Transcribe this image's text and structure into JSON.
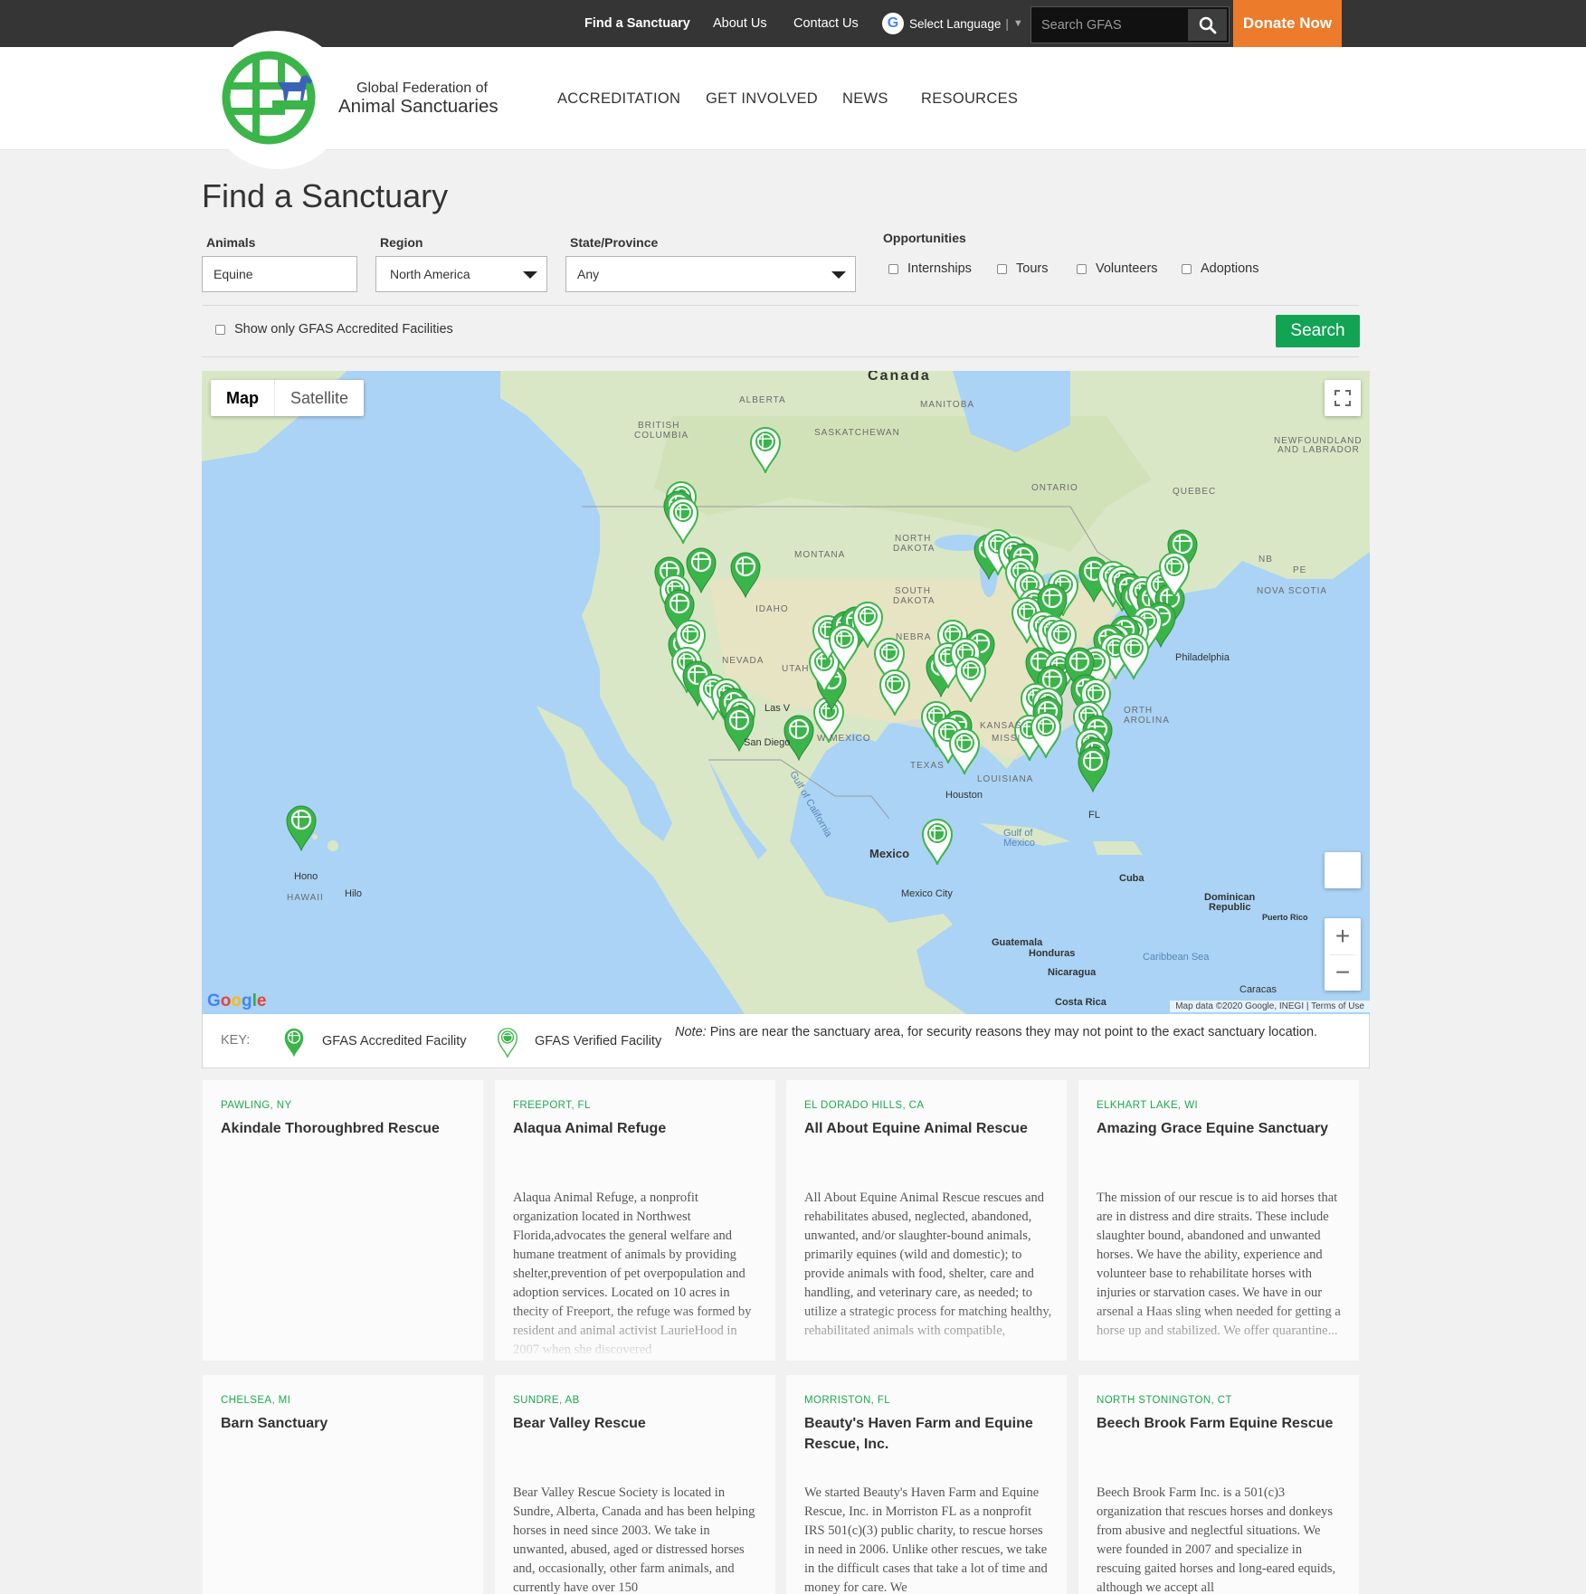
{
  "topbar": {
    "nav": [
      "Find a Sanctuary",
      "About Us",
      "Contact Us"
    ],
    "language_label": "Select Language",
    "language_separator": "|",
    "search_placeholder": "Search GFAS",
    "donate_label": "Donate Now"
  },
  "header": {
    "brand_line1": "Global Federation of",
    "brand_line2": "Animal Sanctuaries",
    "nav": [
      "ACCREDITATION",
      "GET INVOLVED",
      "NEWS",
      "RESOURCES"
    ]
  },
  "page": {
    "title": "Find a Sanctuary"
  },
  "filters": {
    "animals": {
      "label": "Animals",
      "value": "Equine"
    },
    "region": {
      "label": "Region",
      "value": "North America"
    },
    "state": {
      "label": "State/Province",
      "value": "Any"
    },
    "opportunities": {
      "label": "Opportunities",
      "options": [
        "Internships",
        "Tours",
        "Volunteers",
        "Adoptions"
      ]
    },
    "accredited_only_label": "Show only GFAS Accredited Facilities",
    "search_label": "Search"
  },
  "map": {
    "type_map": "Map",
    "type_satellite": "Satellite",
    "labels": {
      "canada": "Canada",
      "alberta": "ALBERTA",
      "manitoba": "MANITOBA",
      "british_columbia_1": "BRITISH",
      "british_columbia_2": "COLUMBIA",
      "saskatchewan": "SASKATCHEWAN",
      "ontario": "ONTARIO",
      "quebec": "QUEBEC",
      "newfoundland_1": "NEWFOUNDLAND",
      "newfoundland_2": "AND LABRADOR",
      "montana": "MONTANA",
      "north_dakota_1": "NORTH",
      "north_dakota_2": "DAKOTA",
      "south_dakota_1": "SOUTH",
      "south_dakota_2": "DAKOTA",
      "idaho": "IDAHO",
      "nevada": "NEVADA",
      "utah": "UTAH",
      "nebraska": "NEBRA",
      "kansas": "KANSAS",
      "texas": "TEXAS",
      "louisiana": "LOUISIANA",
      "missouri": "MISSI",
      "north_carolina_1": "ORTH",
      "north_carolina_2": "AROLINA",
      "new_mexico": "W MEXICO",
      "nova_scotia": "NOVA SCOTIA",
      "nb": "NB",
      "pe": "PE",
      "hawaii": "HAWAII",
      "philadelphia": "Philadelphia",
      "houston": "Houston",
      "san_diego": "San Diego",
      "las_vegas": "Las V",
      "mexico": "Mexico",
      "mexico_city": "Mexico City",
      "cuba": "Cuba",
      "dominican_1": "Dominican",
      "dominican_2": "Republic",
      "puerto_rico": "Puerto Rico",
      "guatemala": "Guatemala",
      "honduras": "Honduras",
      "nicaragua": "Nicaragua",
      "costa_rica": "Costa Rica",
      "caracas": "Caracas",
      "gulf_mexico_1": "Gulf of",
      "gulf_mexico_2": "Mexico",
      "gulf_california": "Gulf of California",
      "caribbean": "Caribbean Sea",
      "honolulu": "Hono",
      "hilo": "Hilo",
      "fl": "FL"
    },
    "google_mark": "Google",
    "attribution": "Map data ©2020 Google, INEGI  |  Terms of Use"
  },
  "key": {
    "label": "KEY:",
    "accredited": "GFAS Accredited Facility",
    "verified": "GFAS Verified Facility",
    "note_prefix": "Note:",
    "note_text": " Pins are near the sanctuary area, for security reasons they may not point to the exact sanctuary location."
  },
  "cards": [
    {
      "location": "PAWLING, NY",
      "name": "Akindale Thoroughbred Rescue",
      "description": ""
    },
    {
      "location": "FREEPORT, FL",
      "name": "Alaqua Animal Refuge",
      "description": "Alaqua Animal Refuge, a nonprofit organization located in Northwest Florida,advocates the general welfare and humane treatment of animals by providing shelter,prevention of pet overpopulation and adoption services. Located on 10 acres in thecity of Freeport, the refuge was formed by resident and animal activist LaurieHood in 2007 when she discovered"
    },
    {
      "location": "EL DORADO HILLS, CA",
      "name": "All About Equine Animal Rescue",
      "description": "All About Equine Animal Rescue rescues and rehabilitates abused, neglected, abandoned, unwanted, and/or slaughter-bound animals, primarily equines (wild and domestic); to provide animals with food, shelter, care and handling, and veterinary care, as needed; to utilize a strategic process for matching healthy, rehabilitated animals with compatible,"
    },
    {
      "location": "ELKHART LAKE, WI",
      "name": "Amazing Grace Equine Sanctuary",
      "description": "The mission of our rescue is to aid horses that are in distress and dire straits. These include slaughter bound, abandoned and unwanted horses. We have the ability, experience and volunteer base to rehabilitate horses with injuries or starvation cases. We have in our arsenal a Haas sling when needed for getting a horse up and stabilized. We offer quarantine..."
    },
    {
      "location": "CHELSEA, MI",
      "name": "Barn Sanctuary",
      "description": ""
    },
    {
      "location": "SUNDRE, AB",
      "name": "Bear Valley Rescue",
      "description": "Bear Valley Rescue Society is located in Sundre, Alberta, Canada and has been helping horses in need since 2003. We take in unwanted, abused, aged or distressed horses and, occasionally, other farm animals, and currently have over 150"
    },
    {
      "location": "MORRISTON, FL",
      "name": "Beauty's Haven Farm and Equine Rescue, Inc.",
      "description": "We started Beauty's Haven Farm and Equine Rescue, Inc. in Morriston FL as a nonprofit IRS 501(c)(3) public charity, to rescue horses in need in 2006. Unlike other rescues, we take in the difficult cases that take a lot of time and money for care. We"
    },
    {
      "location": "NORTH STONINGTON, CT",
      "name": "Beech Brook Farm Equine Rescue",
      "description": "Beech Brook Farm Inc. is a 501(c)3 organization that rescues horses and donkeys from abusive and neglectful situations. We were founded in 2007 and specialize in rescuing gaited horses and long-eared equids, although we accept all"
    }
  ]
}
